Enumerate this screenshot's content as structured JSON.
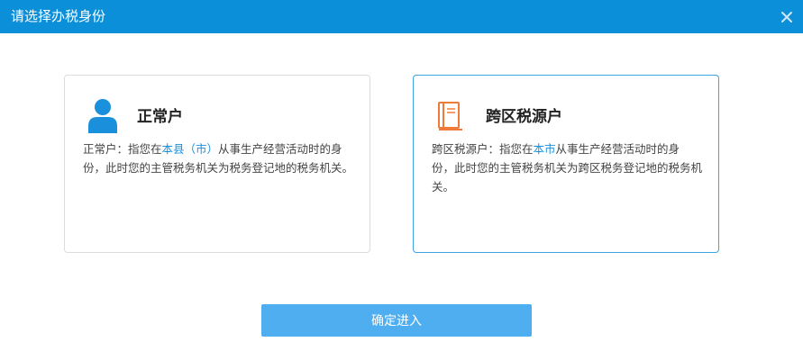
{
  "dialog": {
    "title": "请选择办税身份",
    "close_icon": "close-icon"
  },
  "options": {
    "normal": {
      "icon": "user-icon",
      "icon_color": "#1a8fdb",
      "title": "正常户",
      "desc_prefix": "正常户：指您在",
      "desc_highlight": "本县（市）",
      "desc_suffix": "从事生产经营活动时的身份，此时您的主管税务机关为税务登记地的税务机关。",
      "selected": false
    },
    "cross_region": {
      "icon": "book-icon",
      "icon_color": "#f07a3a",
      "title": "跨区税源户",
      "desc_prefix": "跨区税源户：指您在",
      "desc_highlight": "本市",
      "desc_suffix": "从事生产经营活动时的身份，此时您的主管税务机关为跨区税务登记地的税务机关。",
      "selected": true
    }
  },
  "confirm_button": {
    "label": "确定进入",
    "color": "#4eaef0"
  },
  "colors": {
    "titlebar": "#0a8fd8",
    "highlight": "#1a8fdb",
    "selected_border": "#3aa5e0"
  }
}
